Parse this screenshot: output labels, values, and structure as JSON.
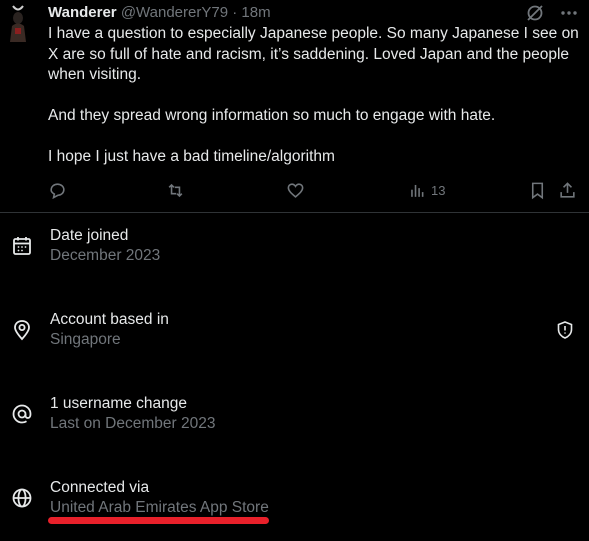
{
  "post": {
    "author": "Wanderer",
    "handle": "@WandererY79",
    "separator": "·",
    "time": "18m",
    "paragraphs": [
      "I have a question to especially Japanese people. So many Japanese I see on X are so full of hate and racism, it’s saddening. Loved Japan and the people when visiting.",
      "And they spread wrong information so much to engage with hate.",
      "I hope I just have a bad timeline/algorithm"
    ],
    "views_count": "13",
    "icons": {
      "grok": "grok-icon",
      "more": "more-options-icon",
      "reply": "reply-icon",
      "repost": "repost-icon",
      "like": "like-icon",
      "views": "views-icon",
      "bookmark": "bookmark-icon",
      "share": "share-icon"
    }
  },
  "account_info": {
    "date_joined": {
      "title": "Date joined",
      "value": "December 2023",
      "icon": "calendar-icon"
    },
    "location": {
      "title": "Account based in",
      "value": "Singapore",
      "icon": "location-pin-icon",
      "badge_icon": "shield-alert-icon"
    },
    "username": {
      "title": "1 username change",
      "value": "Last on December 2023",
      "icon": "at-sign-icon"
    },
    "connected": {
      "title": "Connected via",
      "value": "United Arab Emirates App Store",
      "icon": "globe-icon"
    }
  },
  "colors": {
    "background": "#000000",
    "text": "#e7e9ea",
    "muted": "#71767b",
    "divider": "#2f3336",
    "highlight": "#e8202a"
  }
}
